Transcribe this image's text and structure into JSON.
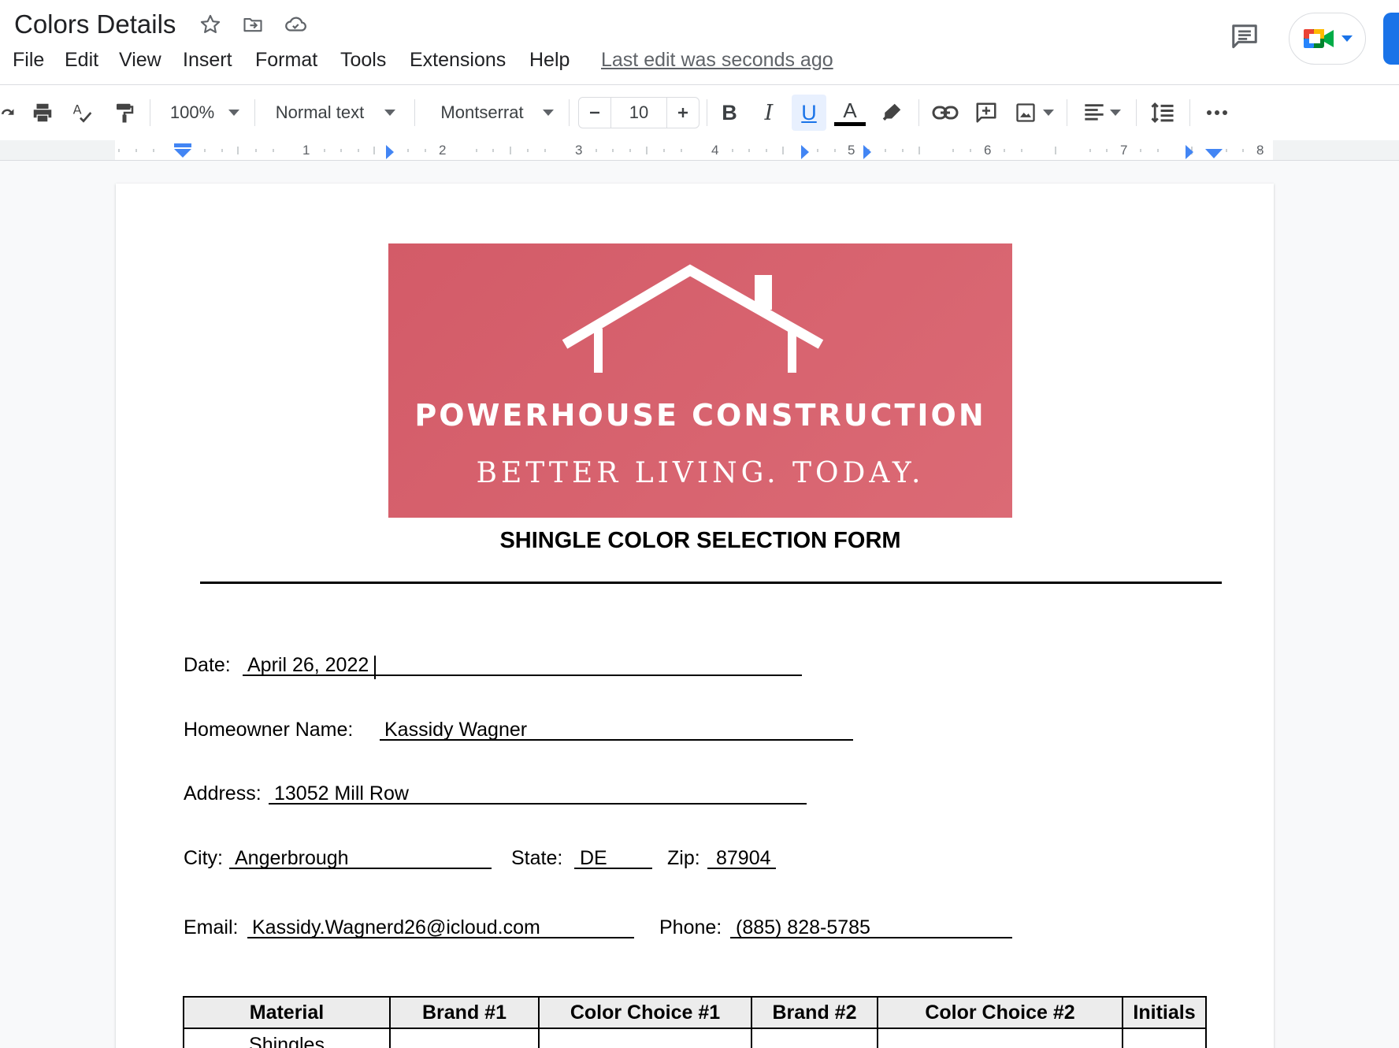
{
  "title_bar": {
    "doc_title": "Colors Details",
    "last_edit": "Last edit was seconds ago"
  },
  "menu": [
    "File",
    "Edit",
    "View",
    "Insert",
    "Format",
    "Tools",
    "Extensions",
    "Help"
  ],
  "toolbar": {
    "zoom": "100%",
    "style": "Normal text",
    "font": "Montserrat",
    "font_size": "10",
    "bold": "B",
    "italic": "I",
    "underline": "U",
    "text_color": "A"
  },
  "ruler": [
    "1",
    "2",
    "3",
    "4",
    "5",
    "6",
    "7",
    "8"
  ],
  "logo": {
    "company": "POWERHOUSE CONSTRUCTION",
    "tagline": "BETTER LIVING. TODAY.",
    "background": "#d65f6c"
  },
  "form": {
    "title": "SHINGLE COLOR SELECTION FORM",
    "date_label": "Date:",
    "date_value": "April 26, 2022",
    "homeowner_label": "Homeowner Name:",
    "homeowner_value": "Kassidy Wagner",
    "address_label": "Address:",
    "address_value": "13052 Mill Row",
    "city_label": "City:",
    "city_value": "Angerbrough",
    "state_label": "State:",
    "state_value": "DE",
    "zip_label": "Zip:",
    "zip_value": "87904",
    "email_label": "Email:",
    "email_value": "Kassidy.Wagnerd26@icloud.com",
    "phone_label": "Phone:",
    "phone_value": "(885) 828-5785"
  },
  "table": {
    "headers": [
      "Material",
      "Brand #1",
      "Color Choice #1",
      "Brand #2",
      "Color Choice #2",
      "Initials"
    ],
    "rows": [
      [
        "Shingles",
        "",
        "",
        "",
        "",
        ""
      ]
    ]
  },
  "colors": {
    "accent_blue": "#1a73e8",
    "underline_active_bg": "#e8f0fe"
  }
}
